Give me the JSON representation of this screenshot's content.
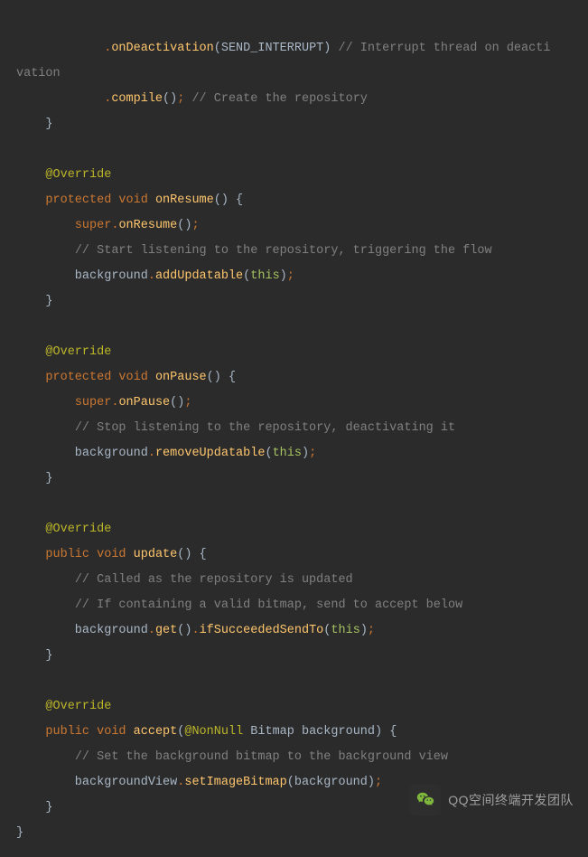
{
  "code": {
    "line01_a": "            ",
    "line01_b": ".",
    "line01_c": "onDeactivation",
    "line01_d": "(SEND_INTERRUPT) ",
    "line01_e": "// Interrupt thread on deacti",
    "line02_a": "vation",
    "line03_a": "            ",
    "line03_b": ".",
    "line03_c": "compile",
    "line03_d": "()",
    "line03_e": ";",
    "line03_f": " // Create the repository",
    "line04_a": "    }",
    "line06_a": "    ",
    "line06_b": "@Override",
    "line07_a": "    ",
    "line07_b": "protected void",
    "line07_c": " ",
    "line07_d": "onResume",
    "line07_e": "() {",
    "line08_a": "        ",
    "line08_b": "super",
    "line08_c": ".",
    "line08_d": "onResume",
    "line08_e": "()",
    "line08_f": ";",
    "line09_a": "        ",
    "line09_b": "// Start listening to the repository, triggering the flow",
    "line10_a": "        background",
    "line10_b": ".",
    "line10_c": "addUpdatable",
    "line10_d": "(",
    "line10_e": "this",
    "line10_f": ")",
    "line10_g": ";",
    "line11_a": "    }",
    "line13_a": "    ",
    "line13_b": "@Override",
    "line14_a": "    ",
    "line14_b": "protected void",
    "line14_c": " ",
    "line14_d": "onPause",
    "line14_e": "() {",
    "line15_a": "        ",
    "line15_b": "super",
    "line15_c": ".",
    "line15_d": "onPause",
    "line15_e": "()",
    "line15_f": ";",
    "line16_a": "        ",
    "line16_b": "// Stop listening to the repository, deactivating it",
    "line17_a": "        background",
    "line17_b": ".",
    "line17_c": "removeUpdatable",
    "line17_d": "(",
    "line17_e": "this",
    "line17_f": ")",
    "line17_g": ";",
    "line18_a": "    }",
    "line20_a": "    ",
    "line20_b": "@Override",
    "line21_a": "    ",
    "line21_b": "public void",
    "line21_c": " ",
    "line21_d": "update",
    "line21_e": "() {",
    "line22_a": "        ",
    "line22_b": "// Called as the repository is updated",
    "line23_a": "        ",
    "line23_b": "// If containing a valid bitmap, send to accept below",
    "line24_a": "        background",
    "line24_b": ".",
    "line24_c": "get",
    "line24_d": "()",
    "line24_e": ".",
    "line24_f": "ifSucceededSendTo",
    "line24_g": "(",
    "line24_h": "this",
    "line24_i": ")",
    "line24_j": ";",
    "line25_a": "    }",
    "line27_a": "    ",
    "line27_b": "@Override",
    "line28_a": "    ",
    "line28_b": "public void",
    "line28_c": " ",
    "line28_d": "accept",
    "line28_e": "(",
    "line28_f": "@NonNull",
    "line28_g": " Bitmap background) {",
    "line29_a": "        ",
    "line29_b": "// Set the background bitmap to the background view",
    "line30_a": "        backgroundView",
    "line30_b": ".",
    "line30_c": "setImageBitmap",
    "line30_d": "(background)",
    "line30_e": ";",
    "line31_a": "    }",
    "line32_a": "}"
  },
  "watermark": {
    "text": "QQ空间终端开发团队"
  }
}
